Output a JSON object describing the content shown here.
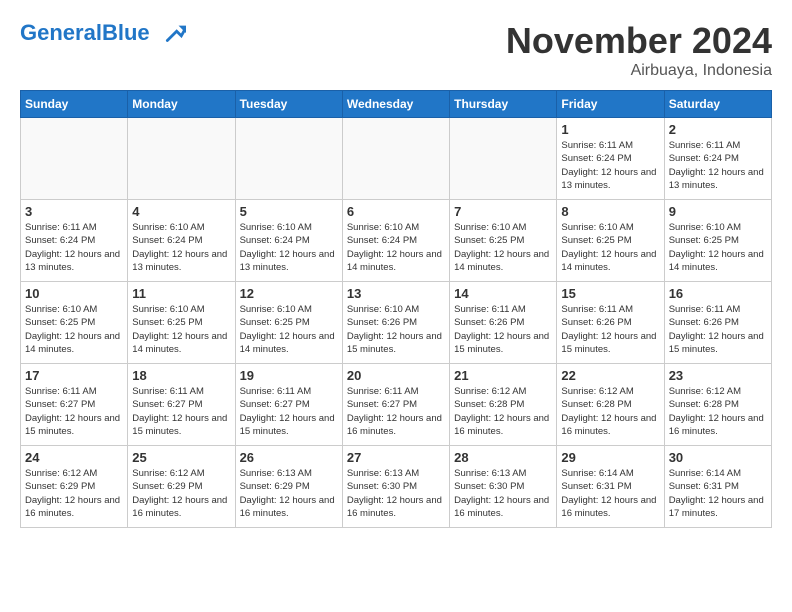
{
  "header": {
    "logo_general": "General",
    "logo_blue": "Blue",
    "month_title": "November 2024",
    "subtitle": "Airbuaya, Indonesia"
  },
  "days_of_week": [
    "Sunday",
    "Monday",
    "Tuesday",
    "Wednesday",
    "Thursday",
    "Friday",
    "Saturday"
  ],
  "weeks": [
    [
      {
        "day": "",
        "info": ""
      },
      {
        "day": "",
        "info": ""
      },
      {
        "day": "",
        "info": ""
      },
      {
        "day": "",
        "info": ""
      },
      {
        "day": "",
        "info": ""
      },
      {
        "day": "1",
        "info": "Sunrise: 6:11 AM\nSunset: 6:24 PM\nDaylight: 12 hours\nand 13 minutes."
      },
      {
        "day": "2",
        "info": "Sunrise: 6:11 AM\nSunset: 6:24 PM\nDaylight: 12 hours\nand 13 minutes."
      }
    ],
    [
      {
        "day": "3",
        "info": "Sunrise: 6:11 AM\nSunset: 6:24 PM\nDaylight: 12 hours\nand 13 minutes."
      },
      {
        "day": "4",
        "info": "Sunrise: 6:10 AM\nSunset: 6:24 PM\nDaylight: 12 hours\nand 13 minutes."
      },
      {
        "day": "5",
        "info": "Sunrise: 6:10 AM\nSunset: 6:24 PM\nDaylight: 12 hours\nand 13 minutes."
      },
      {
        "day": "6",
        "info": "Sunrise: 6:10 AM\nSunset: 6:24 PM\nDaylight: 12 hours\nand 14 minutes."
      },
      {
        "day": "7",
        "info": "Sunrise: 6:10 AM\nSunset: 6:25 PM\nDaylight: 12 hours\nand 14 minutes."
      },
      {
        "day": "8",
        "info": "Sunrise: 6:10 AM\nSunset: 6:25 PM\nDaylight: 12 hours\nand 14 minutes."
      },
      {
        "day": "9",
        "info": "Sunrise: 6:10 AM\nSunset: 6:25 PM\nDaylight: 12 hours\nand 14 minutes."
      }
    ],
    [
      {
        "day": "10",
        "info": "Sunrise: 6:10 AM\nSunset: 6:25 PM\nDaylight: 12 hours\nand 14 minutes."
      },
      {
        "day": "11",
        "info": "Sunrise: 6:10 AM\nSunset: 6:25 PM\nDaylight: 12 hours\nand 14 minutes."
      },
      {
        "day": "12",
        "info": "Sunrise: 6:10 AM\nSunset: 6:25 PM\nDaylight: 12 hours\nand 14 minutes."
      },
      {
        "day": "13",
        "info": "Sunrise: 6:10 AM\nSunset: 6:26 PM\nDaylight: 12 hours\nand 15 minutes."
      },
      {
        "day": "14",
        "info": "Sunrise: 6:11 AM\nSunset: 6:26 PM\nDaylight: 12 hours\nand 15 minutes."
      },
      {
        "day": "15",
        "info": "Sunrise: 6:11 AM\nSunset: 6:26 PM\nDaylight: 12 hours\nand 15 minutes."
      },
      {
        "day": "16",
        "info": "Sunrise: 6:11 AM\nSunset: 6:26 PM\nDaylight: 12 hours\nand 15 minutes."
      }
    ],
    [
      {
        "day": "17",
        "info": "Sunrise: 6:11 AM\nSunset: 6:27 PM\nDaylight: 12 hours\nand 15 minutes."
      },
      {
        "day": "18",
        "info": "Sunrise: 6:11 AM\nSunset: 6:27 PM\nDaylight: 12 hours\nand 15 minutes."
      },
      {
        "day": "19",
        "info": "Sunrise: 6:11 AM\nSunset: 6:27 PM\nDaylight: 12 hours\nand 15 minutes."
      },
      {
        "day": "20",
        "info": "Sunrise: 6:11 AM\nSunset: 6:27 PM\nDaylight: 12 hours\nand 16 minutes."
      },
      {
        "day": "21",
        "info": "Sunrise: 6:12 AM\nSunset: 6:28 PM\nDaylight: 12 hours\nand 16 minutes."
      },
      {
        "day": "22",
        "info": "Sunrise: 6:12 AM\nSunset: 6:28 PM\nDaylight: 12 hours\nand 16 minutes."
      },
      {
        "day": "23",
        "info": "Sunrise: 6:12 AM\nSunset: 6:28 PM\nDaylight: 12 hours\nand 16 minutes."
      }
    ],
    [
      {
        "day": "24",
        "info": "Sunrise: 6:12 AM\nSunset: 6:29 PM\nDaylight: 12 hours\nand 16 minutes."
      },
      {
        "day": "25",
        "info": "Sunrise: 6:12 AM\nSunset: 6:29 PM\nDaylight: 12 hours\nand 16 minutes."
      },
      {
        "day": "26",
        "info": "Sunrise: 6:13 AM\nSunset: 6:29 PM\nDaylight: 12 hours\nand 16 minutes."
      },
      {
        "day": "27",
        "info": "Sunrise: 6:13 AM\nSunset: 6:30 PM\nDaylight: 12 hours\nand 16 minutes."
      },
      {
        "day": "28",
        "info": "Sunrise: 6:13 AM\nSunset: 6:30 PM\nDaylight: 12 hours\nand 16 minutes."
      },
      {
        "day": "29",
        "info": "Sunrise: 6:14 AM\nSunset: 6:31 PM\nDaylight: 12 hours\nand 16 minutes."
      },
      {
        "day": "30",
        "info": "Sunrise: 6:14 AM\nSunset: 6:31 PM\nDaylight: 12 hours\nand 17 minutes."
      }
    ]
  ]
}
